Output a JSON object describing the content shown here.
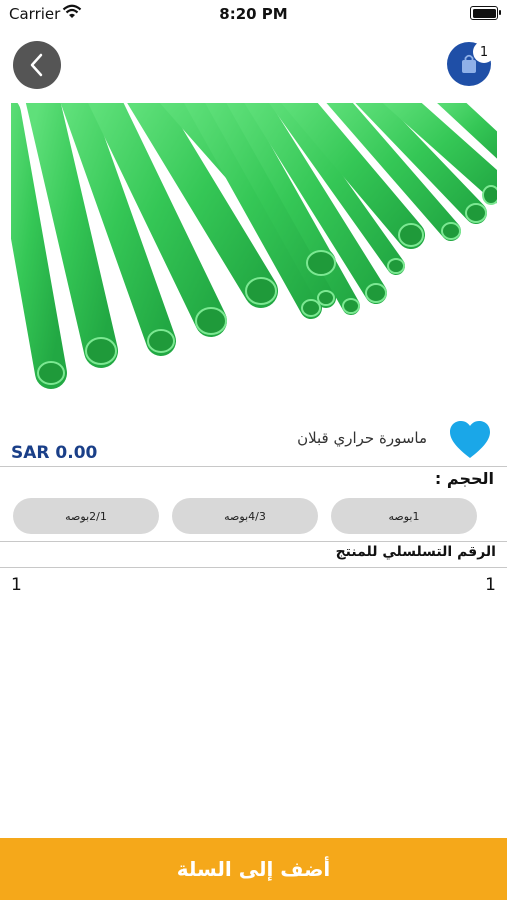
{
  "status_bar": {
    "carrier": "Carrier",
    "time": "8:20 PM"
  },
  "header": {
    "cart_count": "1"
  },
  "product": {
    "name": "ماسورة حراري قبلان",
    "price": "SAR  0.00",
    "favorite_color": "#1aa7e8"
  },
  "size": {
    "label": "الحجم :",
    "options": [
      "1بوصه",
      "4/3بوصه",
      "2/1بوصه"
    ]
  },
  "serial": {
    "label": "الرقم التسلسلي للمنتج",
    "value_left": "1",
    "value_right": "1"
  },
  "add_to_cart": {
    "label": "أضف إلى السلة",
    "color": "#f5a81a"
  },
  "colors": {
    "accent_blue": "#1f4fa7",
    "price_blue": "#1a3f88",
    "pipe_green": "#3ccf5c"
  }
}
